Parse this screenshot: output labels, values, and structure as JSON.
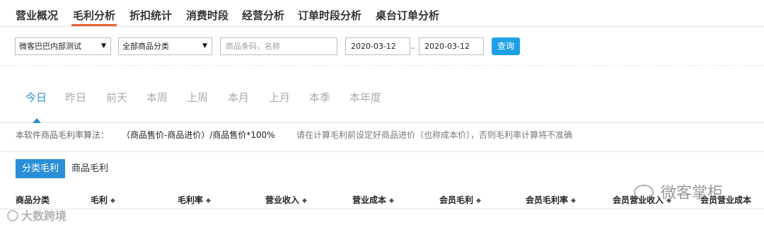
{
  "top_tabs": [
    "营业概况",
    "毛利分析",
    "折扣统计",
    "消费时段",
    "经营分析",
    "订单时段分析",
    "桌台订单分析"
  ],
  "active_top_tab": "毛利分析",
  "filters": {
    "store_select": "微客巴巴内部测试",
    "category_select": "全部商品分类",
    "product_search_placeholder": "商品条码，名称",
    "start_date": "2020-03-12",
    "range_separator": "–",
    "end_date": "2020-03-12",
    "query_button": "查询"
  },
  "day_tabs": [
    "今日",
    "昨日",
    "前天",
    "本周",
    "上周",
    "本月",
    "上月",
    "本季",
    "本年度"
  ],
  "active_day_tab": "今日",
  "formula": {
    "label": "本软件商品毛利率算法：",
    "expression": "（商品售价-商品进价）/商品售价*100%",
    "note": "请在计算毛利前设定好商品进价（也称成本价），否则毛利率计算将不准确"
  },
  "sub_tabs": [
    "分类毛利",
    "商品毛利"
  ],
  "active_sub_tab": "分类毛利",
  "table_headers": [
    "商品分类",
    "毛利",
    "毛利率",
    "营业收入",
    "营业成本",
    "会员毛利",
    "会员毛利率",
    "会员营业收入",
    "会员营业成本"
  ],
  "watermarks": {
    "left": "大数跨境",
    "right": "微客掌柜"
  },
  "colors": {
    "accent_blue": "#2a8fd8",
    "query_button": "#1ea0e6",
    "active_tab_underline": "#e8643a"
  }
}
